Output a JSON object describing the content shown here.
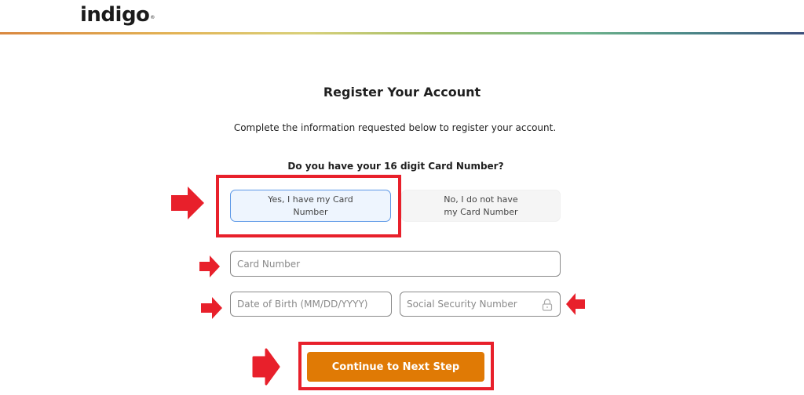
{
  "header": {
    "logo_text": "indigo",
    "logo_mark": "®"
  },
  "page": {
    "title": "Register Your Account",
    "subtitle": "Complete the information requested below to register your account.",
    "question": "Do you have your 16 digit Card Number?"
  },
  "options": {
    "yes": {
      "label": "Yes, I have my Card Number",
      "selected": true
    },
    "no": {
      "label": "No, I do not have my Card Number",
      "selected": false
    }
  },
  "form": {
    "card_number": {
      "placeholder": "Card Number",
      "value": ""
    },
    "dob": {
      "placeholder": "Date of Birth (MM/DD/YYYY)",
      "value": ""
    },
    "ssn": {
      "placeholder": "Social Security Number",
      "value": "",
      "icon": "lock-icon"
    }
  },
  "actions": {
    "continue_label": "Continue to Next Step"
  },
  "colors": {
    "accent_button": "#e07a05",
    "selected_option_border": "#5b97e6",
    "annotation_red": "#e8202b"
  }
}
